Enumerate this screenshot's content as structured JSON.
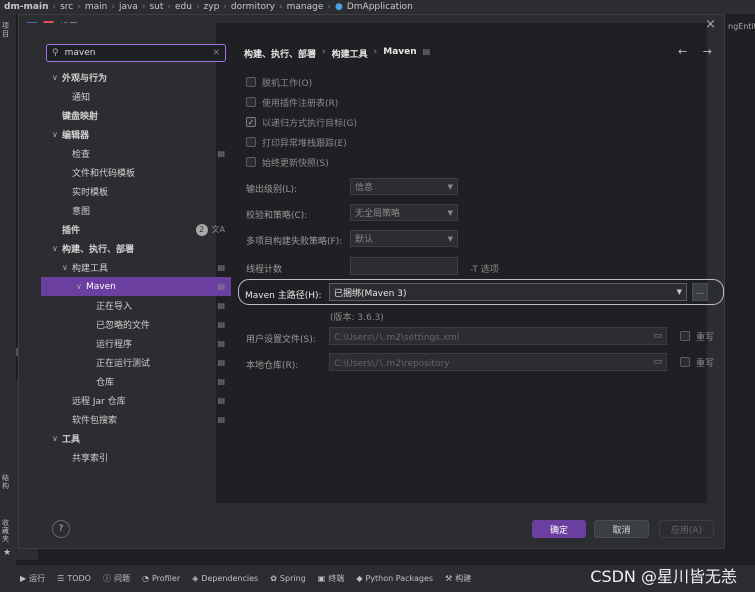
{
  "ide": {
    "breadcrumb": [
      "dm-main",
      "src",
      "main",
      "java",
      "sut",
      "edu",
      "zyp",
      "dormitory",
      "manage",
      "DmApplication"
    ],
    "right_tab": "ngEntit",
    "left_rail": {
      "project": "项目",
      "structure": "结构",
      "favorites": "收藏夹"
    },
    "run_label": "运行",
    "bottom_tools": [
      {
        "icon": "run-icon",
        "label": "运行"
      },
      {
        "icon": "list-icon",
        "label": "TODO"
      },
      {
        "icon": "info-icon",
        "label": "问题"
      },
      {
        "icon": "profiler-icon",
        "label": "Profiler"
      },
      {
        "icon": "layers-icon",
        "label": "Dependencies"
      },
      {
        "icon": "spring-icon",
        "label": "Spring"
      },
      {
        "icon": "terminal-icon",
        "label": "终端"
      },
      {
        "icon": "python-icon",
        "label": "Python Packages"
      },
      {
        "icon": "build-icon",
        "label": "构建"
      }
    ],
    "watermark": "CSDN @星川皆无恙"
  },
  "dialog": {
    "title": "设置",
    "close": "×",
    "search": {
      "value": "maven",
      "placeholder": "",
      "clear": "×"
    },
    "tree": [
      {
        "label": "外观与行为",
        "arrow": "∨",
        "bold": true
      },
      {
        "label": "通知",
        "arrow": "",
        "bold": false
      },
      {
        "label": "键盘映射",
        "arrow": "",
        "bold": true
      },
      {
        "label": "编辑器",
        "arrow": "∨",
        "bold": true
      },
      {
        "label": "检查",
        "arrow": "",
        "bold": false,
        "gear": true
      },
      {
        "label": "文件和代码模板",
        "arrow": "",
        "bold": false
      },
      {
        "label": "实时模板",
        "arrow": "",
        "bold": false
      },
      {
        "label": "意图",
        "arrow": "",
        "bold": false
      },
      {
        "label": "插件",
        "arrow": "",
        "bold": true,
        "badge": "2"
      },
      {
        "label": "构建、执行、部署",
        "arrow": "∨",
        "bold": true
      },
      {
        "label": "构建工具",
        "arrow": "∨",
        "bold": false,
        "gear": true
      },
      {
        "label": "Maven",
        "arrow": "∨",
        "bold": false,
        "gear": true,
        "selected": true
      },
      {
        "label": "正在导入",
        "arrow": "",
        "bold": false,
        "gear": true
      },
      {
        "label": "已忽略的文件",
        "arrow": "",
        "bold": false,
        "gear": true
      },
      {
        "label": "运行程序",
        "arrow": "",
        "bold": false,
        "gear": true
      },
      {
        "label": "正在运行测试",
        "arrow": "",
        "bold": false,
        "gear": true
      },
      {
        "label": "仓库",
        "arrow": "",
        "bold": false,
        "gear": true
      },
      {
        "label": "远程 Jar 仓库",
        "arrow": "",
        "bold": false,
        "gear": true
      },
      {
        "label": "软件包搜索",
        "arrow": "",
        "bold": false,
        "gear": true
      },
      {
        "label": "工具",
        "arrow": "∨",
        "bold": true
      },
      {
        "label": "共享索引",
        "arrow": "",
        "bold": false
      }
    ],
    "content": {
      "crumb": [
        "构建、执行、部署",
        "构建工具",
        "Maven"
      ],
      "nav": "← →",
      "checkboxes": [
        {
          "label": "脱机工作(O)",
          "checked": false
        },
        {
          "label": "使用插件注册表(R)",
          "checked": false
        },
        {
          "label": "以递归方式执行目标(G)",
          "checked": true
        },
        {
          "label": "打印异常堆栈跟踪(E)",
          "checked": false
        },
        {
          "label": "始终更新快照(S)",
          "checked": false
        }
      ],
      "output_level": {
        "label": "输出级别(L):",
        "value": "信息"
      },
      "checksum_policy": {
        "label": "校验和策略(C):",
        "value": "无全局策略"
      },
      "multiproject_failure": {
        "label": "多项目构建失败策略(F):",
        "value": "默认"
      },
      "thread_count": {
        "label": "线程计数",
        "value": "",
        "hint": "-T 选项"
      },
      "maven_home": {
        "label": "Maven 主路径(H):",
        "value": "已捆绑(Maven 3)",
        "version": "(版本: 3.6.3)",
        "browse": "..."
      },
      "user_settings": {
        "label": "用户设置文件(S):",
        "value": "C:\\Users\\八.m2\\settings.xml",
        "override": "重写"
      },
      "local_repo": {
        "label": "本地仓库(R):",
        "value": "C:\\Users\\八.m2\\repository",
        "override": "重写"
      }
    },
    "footer": {
      "help": "?",
      "ok": "确定",
      "cancel": "取消",
      "apply": "应用(A)"
    }
  },
  "colors": {
    "accent": "#6b3fa0",
    "search_border": "#a574e6",
    "background": "#1e1f22",
    "panel": "#2b2d30"
  }
}
